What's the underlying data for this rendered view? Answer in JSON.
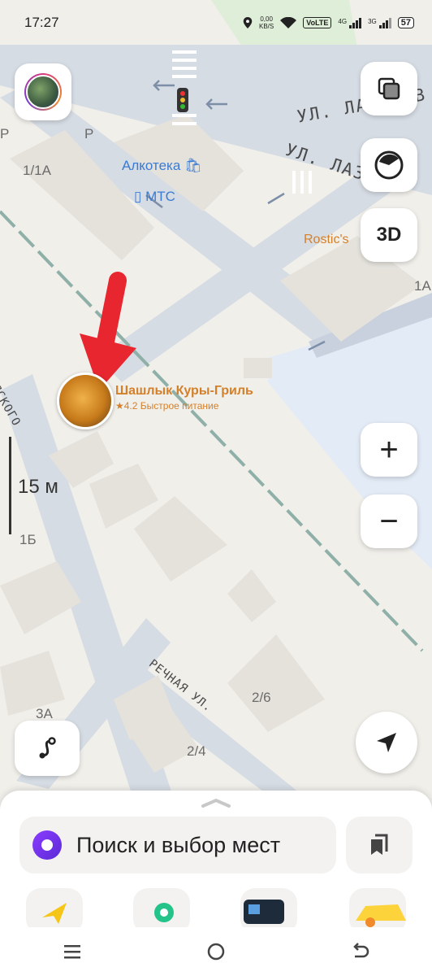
{
  "status_bar": {
    "time": "17:27",
    "speed_value": "0,00",
    "speed_unit": "KB/S",
    "volte": "VoLTE",
    "net1": "4G",
    "net2": "3G",
    "battery": "57"
  },
  "map": {
    "streets": [
      "УЛ. ЛАЗАРЕВ",
      "УЛ. ЛАЗА",
      "РЕЧНАЯ УЛ.",
      "ЯСКОГО"
    ],
    "houses": [
      "1/1А",
      "1А",
      "1Б",
      "3А",
      "2/6",
      "2/4"
    ],
    "parking": [
      "Р",
      "Р"
    ],
    "places": {
      "alkoteka": "Алкотека",
      "mts": "МТС",
      "rostics": "Rostic's"
    },
    "poi": {
      "name": "Шашлык Куры-Гриль",
      "rating_line": "★4.2 Быстрое питание"
    },
    "scale": "15 м"
  },
  "controls": {
    "three_d": "3D",
    "zoom_in": "+",
    "zoom_out": "−"
  },
  "search": {
    "placeholder": "Поиск и выбор мест"
  },
  "colors": {
    "brand_purple": "#7a3bff",
    "poi_orange": "#d4802a",
    "poi_blue": "#3a7bd5",
    "arrow_red": "#e8262f"
  }
}
